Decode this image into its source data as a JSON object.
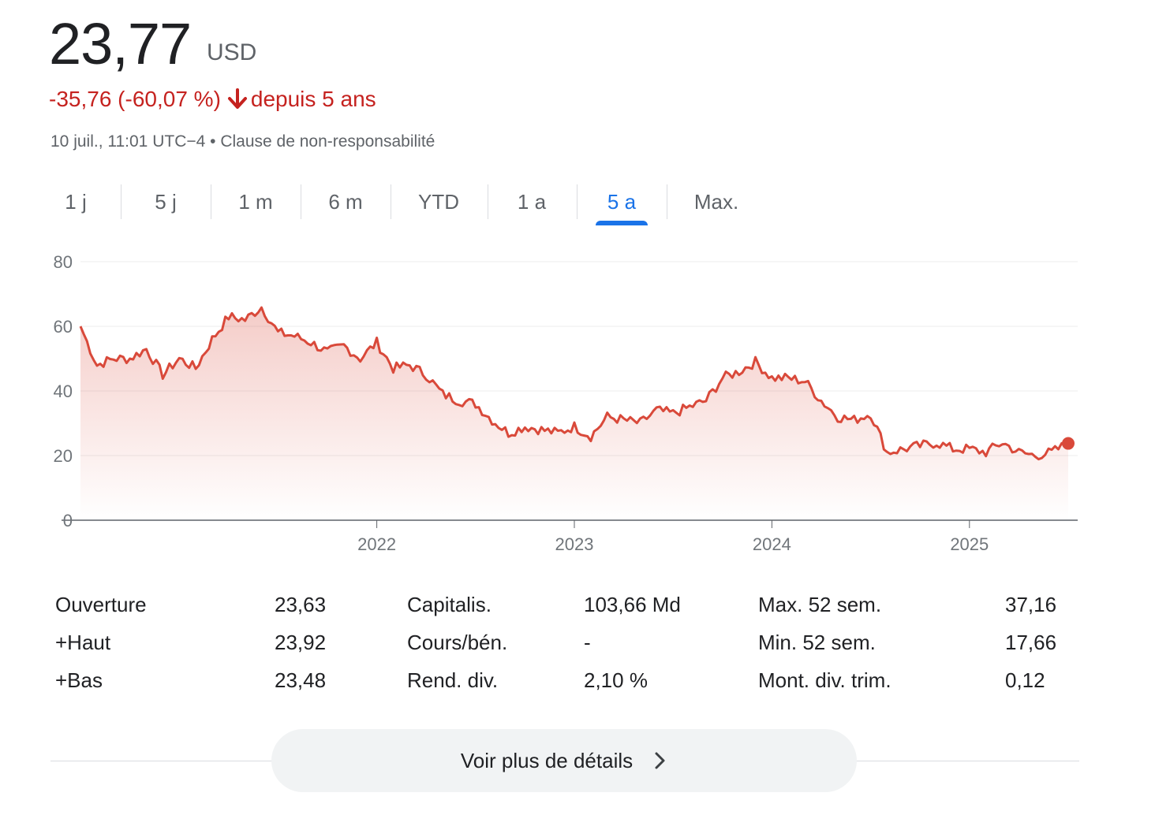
{
  "quote": {
    "price": "23,77",
    "currency": "USD",
    "change": "-35,76 (-60,07 %)",
    "period": "depuis 5 ans",
    "timestamp": "10 juil., 11:01 UTC−4 • Clause de non-responsabilité"
  },
  "colors": {
    "negative": "#c5221f",
    "line": "#d9493a",
    "accent": "#1a73e8"
  },
  "tabs": [
    {
      "label": "1 j",
      "active": false
    },
    {
      "label": "5 j",
      "active": false
    },
    {
      "label": "1 m",
      "active": false
    },
    {
      "label": "6 m",
      "active": false
    },
    {
      "label": "YTD",
      "active": false
    },
    {
      "label": "1 a",
      "active": false
    },
    {
      "label": "5 a",
      "active": true
    },
    {
      "label": "Max.",
      "active": false
    }
  ],
  "chart_data": {
    "type": "area",
    "ylim": [
      0,
      80
    ],
    "y_ticks": [
      "80",
      "60",
      "40",
      "20",
      "0"
    ],
    "x_ticks": [
      "2022",
      "2023",
      "2024",
      "2025"
    ],
    "grid": true,
    "x": [
      "2020-07",
      "2020-08",
      "2020-09",
      "2020-10",
      "2020-11",
      "2020-12",
      "2021-01",
      "2021-02",
      "2021-03",
      "2021-04",
      "2021-05",
      "2021-06",
      "2021-07",
      "2021-08",
      "2021-09",
      "2021-10",
      "2021-11",
      "2021-12",
      "2022-01",
      "2022-02",
      "2022-03",
      "2022-04",
      "2022-05",
      "2022-06",
      "2022-07",
      "2022-08",
      "2022-09",
      "2022-10",
      "2022-11",
      "2022-12",
      "2023-01",
      "2023-02",
      "2023-03",
      "2023-04",
      "2023-05",
      "2023-06",
      "2023-07",
      "2023-08",
      "2023-09",
      "2023-10",
      "2023-11",
      "2023-12",
      "2024-01",
      "2024-02",
      "2024-03",
      "2024-04",
      "2024-05",
      "2024-06",
      "2024-07",
      "2024-08",
      "2024-09",
      "2024-10",
      "2024-11",
      "2024-12",
      "2025-01",
      "2025-02",
      "2025-03",
      "2025-04",
      "2025-05",
      "2025-06",
      "2025-07"
    ],
    "values": [
      60,
      48,
      50,
      50,
      53,
      45,
      50,
      47,
      56,
      63,
      62,
      66,
      58,
      57,
      55,
      52,
      54,
      50,
      55,
      47,
      48,
      45,
      39,
      37,
      36,
      31,
      27,
      29,
      28,
      27,
      29,
      26,
      32,
      31,
      30,
      34,
      33,
      35,
      37,
      44,
      46,
      49,
      44,
      44,
      43,
      37,
      32,
      31,
      33,
      21,
      22,
      23,
      24,
      22,
      22,
      21,
      24,
      21,
      20,
      21,
      23.77
    ],
    "last_value": 23.77
  },
  "stats": {
    "col1": [
      {
        "label": "Ouverture",
        "value": "23,63"
      },
      {
        "label": "+Haut",
        "value": "23,92"
      },
      {
        "label": "+Bas",
        "value": "23,48"
      }
    ],
    "col2": [
      {
        "label": "Capitalis.",
        "value": "103,66 Md"
      },
      {
        "label": "Cours/bén.",
        "value": "-"
      },
      {
        "label": "Rend. div.",
        "value": "2,10 %"
      }
    ],
    "col3": [
      {
        "label": "Max. 52 sem.",
        "value": "37,16"
      },
      {
        "label": "Min. 52 sem.",
        "value": "17,66"
      },
      {
        "label": "Mont. div. trim.",
        "value": "0,12"
      }
    ]
  },
  "details_button": {
    "label": "Voir plus de détails",
    "icon": "chevron-right-icon"
  }
}
